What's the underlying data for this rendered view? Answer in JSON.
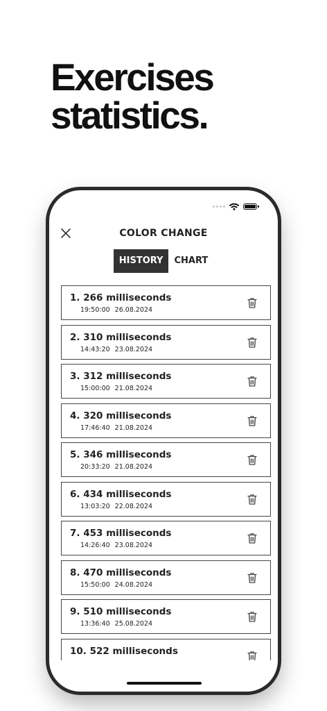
{
  "headline": {
    "line1": "Exercises",
    "line2": "statistics."
  },
  "screen": {
    "title": "COLOR CHANGE",
    "tabs": [
      {
        "label": "HISTORY",
        "active": true
      },
      {
        "label": "CHART",
        "active": false
      }
    ]
  },
  "icons": {
    "close": "close-icon",
    "delete": "trash-icon",
    "wifi": "wifi-icon",
    "battery": "battery-icon"
  },
  "history": [
    {
      "title": "1. 266 milliseconds",
      "time": "19:50:00",
      "date": "26.08.2024"
    },
    {
      "title": "2. 310 milliseconds",
      "time": "14:43:20",
      "date": "23.08.2024"
    },
    {
      "title": "3. 312 milliseconds",
      "time": "15:00:00",
      "date": "21.08.2024"
    },
    {
      "title": "4. 320 milliseconds",
      "time": "17:46:40",
      "date": "21.08.2024"
    },
    {
      "title": "5. 346 milliseconds",
      "time": "20:33:20",
      "date": "21.08.2024"
    },
    {
      "title": "6. 434 milliseconds",
      "time": "13:03:20",
      "date": "22.08.2024"
    },
    {
      "title": "7. 453 milliseconds",
      "time": "14:26:40",
      "date": "23.08.2024"
    },
    {
      "title": "8. 470 milliseconds",
      "time": "15:50:00",
      "date": "24.08.2024"
    },
    {
      "title": "9. 510 milliseconds",
      "time": "13:36:40",
      "date": "25.08.2024"
    },
    {
      "title": "10. 522 milliseconds"
    }
  ]
}
